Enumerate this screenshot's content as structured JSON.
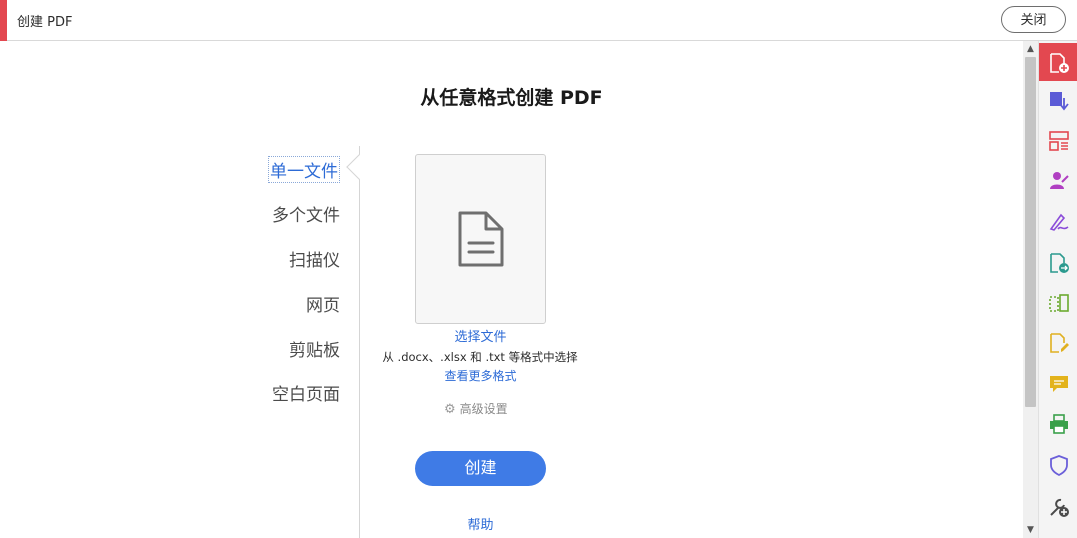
{
  "header": {
    "title": "创建 PDF",
    "close_label": "关闭"
  },
  "main": {
    "heading": "从任意格式创建 PDF",
    "nav": [
      {
        "label": "单一文件",
        "active": true
      },
      {
        "label": "多个文件",
        "active": false
      },
      {
        "label": "扫描仪",
        "active": false
      },
      {
        "label": "网页",
        "active": false
      },
      {
        "label": "剪贴板",
        "active": false
      },
      {
        "label": "空白页面",
        "active": false
      }
    ],
    "select_file": "选择文件",
    "formats_text": "从 .docx、.xlsx 和 .txt 等格式中选择",
    "more_formats": "查看更多格式",
    "advanced_settings": "高级设置",
    "create_label": "创建",
    "help_label": "帮助"
  },
  "tools": [
    {
      "icon": "create-pdf-icon",
      "color": "#ffffff",
      "active": true
    },
    {
      "icon": "export-pdf-icon",
      "color": "#5b5bd6"
    },
    {
      "icon": "organize-pages-icon",
      "color": "#e34850"
    },
    {
      "icon": "request-signature-icon",
      "color": "#b03fc2"
    },
    {
      "icon": "fill-sign-icon",
      "color": "#8b4cd9"
    },
    {
      "icon": "send-for-review-icon",
      "color": "#2b9a8e"
    },
    {
      "icon": "compare-files-icon",
      "color": "#6aaa2e"
    },
    {
      "icon": "edit-pdf-icon",
      "color": "#e0b020"
    },
    {
      "icon": "comment-icon",
      "color": "#e3b31c"
    },
    {
      "icon": "print-production-icon",
      "color": "#3aa04a"
    },
    {
      "icon": "protect-icon",
      "color": "#6b5fd9"
    },
    {
      "icon": "more-tools-icon",
      "color": "#4b4b4b"
    }
  ],
  "colors": {
    "accent": "#e34850",
    "link": "#2d6bd6",
    "primary_button": "#3f7be6"
  }
}
